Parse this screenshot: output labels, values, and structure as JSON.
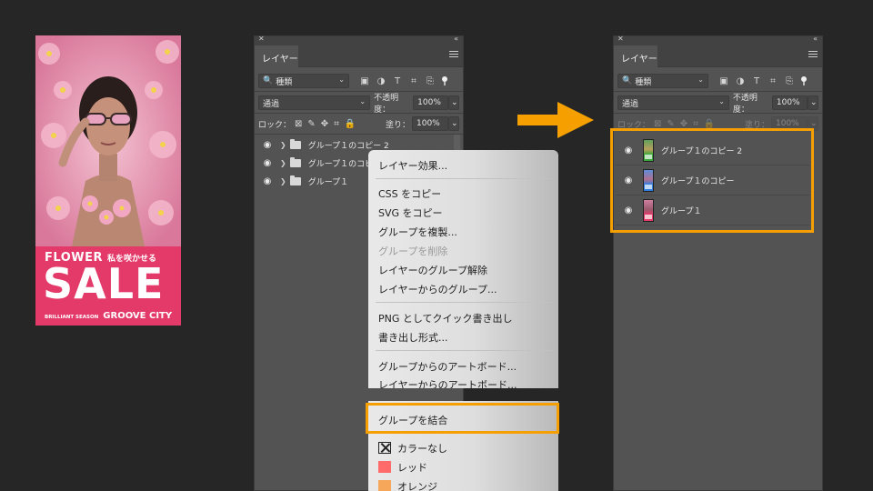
{
  "poster": {
    "flower": "FLOWER",
    "tagline": "私を咲かせる",
    "sale": "SALE",
    "season": "BRILLIANT SEASON",
    "city": "GROOVE CITY"
  },
  "panel_left": {
    "tab": "レイヤー",
    "filter_value": "種類",
    "blend_mode": "通過",
    "opacity_label": "不透明度：",
    "opacity_value": "100%",
    "lock_label": "ロック：",
    "fill_label": "塗り：",
    "fill_value": "100%",
    "layers": [
      {
        "name": "グループ１のコピー 2"
      },
      {
        "name": "グループ１のコピー"
      },
      {
        "name": "グループ１"
      }
    ]
  },
  "context_menu": {
    "items": [
      {
        "label": "レイヤー効果...",
        "enabled": true
      },
      {
        "label": "CSS をコピー",
        "enabled": true
      },
      {
        "label": "SVG をコピー",
        "enabled": true
      },
      {
        "label": "グループを複製...",
        "enabled": true
      },
      {
        "label": "グループを削除",
        "enabled": false
      },
      {
        "label": "レイヤーのグループ解除",
        "enabled": true
      },
      {
        "label": "レイヤーからのグループ...",
        "enabled": true
      },
      {
        "label": "PNG としてクイック書き出し",
        "enabled": true
      },
      {
        "label": "書き出し形式...",
        "enabled": true
      },
      {
        "label": "グループからのアートボード...",
        "enabled": true
      },
      {
        "label": "レイヤーからのアートボード...",
        "enabled": true
      },
      {
        "label": "グループを結合",
        "enabled": true
      }
    ],
    "colors": [
      {
        "label": "カラーなし",
        "color": "none"
      },
      {
        "label": "レッド",
        "color": "#ff6b6b"
      },
      {
        "label": "オレンジ",
        "color": "#f7a75a"
      }
    ]
  },
  "panel_right": {
    "tab": "レイヤー",
    "filter_value": "種類",
    "blend_mode": "通過",
    "opacity_label": "不透明度：",
    "opacity_value": "100%",
    "lock_label": "ロック：",
    "fill_label": "塗り：",
    "fill_value": "100%",
    "layers": [
      {
        "name": "グループ１のコピー 2"
      },
      {
        "name": "グループ１のコピー"
      },
      {
        "name": "グループ１"
      }
    ]
  },
  "accent_color": "#f5a000"
}
